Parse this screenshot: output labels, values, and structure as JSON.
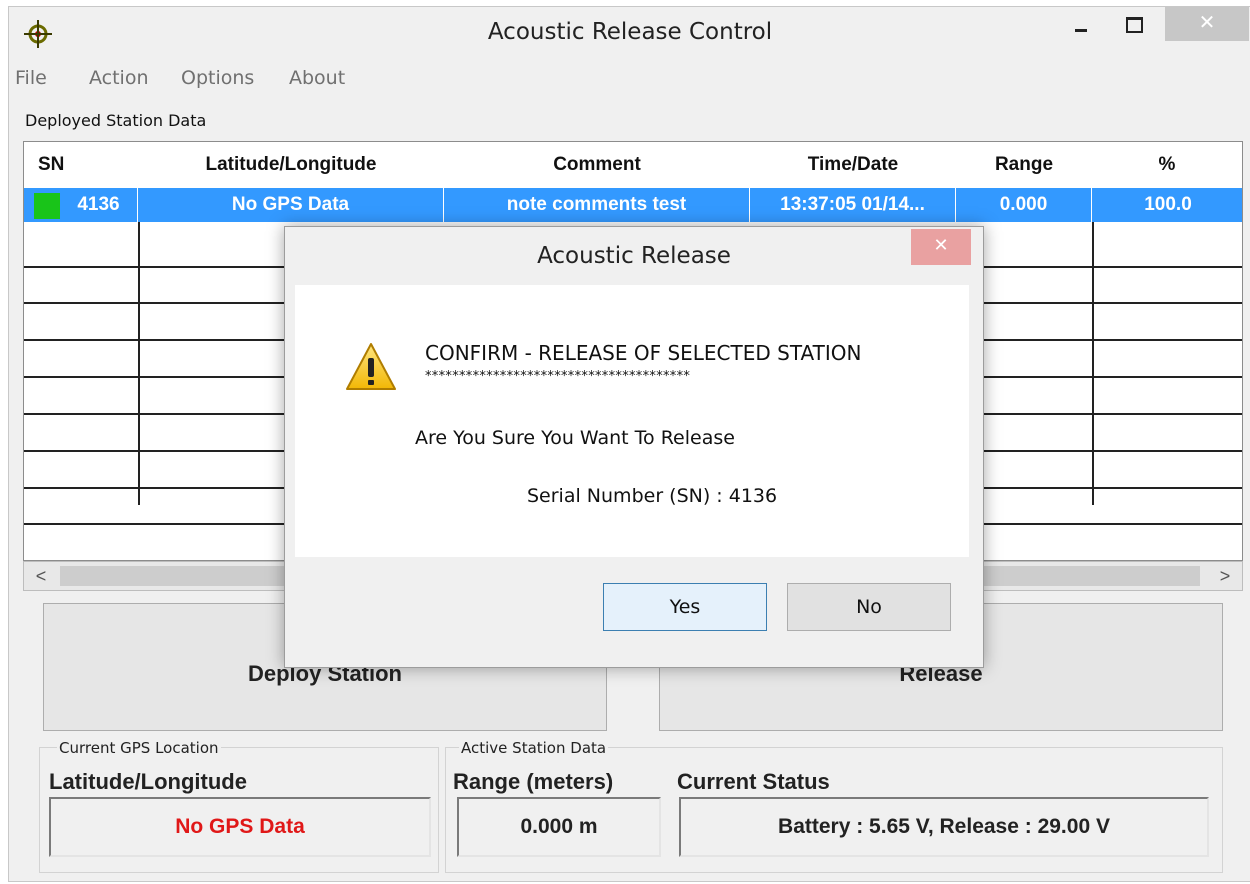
{
  "window": {
    "title": "Acoustic Release Control",
    "close_glyph": "✕"
  },
  "icons": {
    "app": "crosshair-icon",
    "warning": "warning-icon"
  },
  "menu": [
    "File",
    "Action",
    "Options",
    "About"
  ],
  "deployed_section": {
    "label": "Deployed Station Data"
  },
  "table": {
    "columns": [
      "SN",
      "Latitude/Longitude",
      "Comment",
      "Time/Date",
      "Range",
      "%"
    ],
    "selected_row": {
      "sn": "4136",
      "latlon": "No GPS Data",
      "comment": "note comments test",
      "time_date": "13:37:05 01/14...",
      "range": "0.000",
      "percent": "100.0"
    }
  },
  "scroll": {
    "left": "<",
    "right": ">"
  },
  "buttons": {
    "deploy": "Deploy Station",
    "release": "Release"
  },
  "gps_group": {
    "caption": "Current GPS Location",
    "label": "Latitude/Longitude",
    "value": "No GPS Data"
  },
  "active_group": {
    "caption": "Active Station Data",
    "label": "Range (meters)",
    "value": "0.000 m"
  },
  "status": {
    "label": "Current Status",
    "value": "Battery : 5.65 V, Release : 29.00 V"
  },
  "dialog": {
    "title": "Acoustic Release",
    "close_glyph": "✕",
    "heading": "CONFIRM  -  RELEASE OF SELECTED STATION",
    "stars": "***************************************",
    "question": "Are You Sure You Want To Release",
    "serial": "Serial Number (SN) : 4136",
    "yes": "Yes",
    "no": "No"
  },
  "colors": {
    "selection": "#3399ff",
    "status_green": "#19c419",
    "error_red": "#e01818"
  }
}
